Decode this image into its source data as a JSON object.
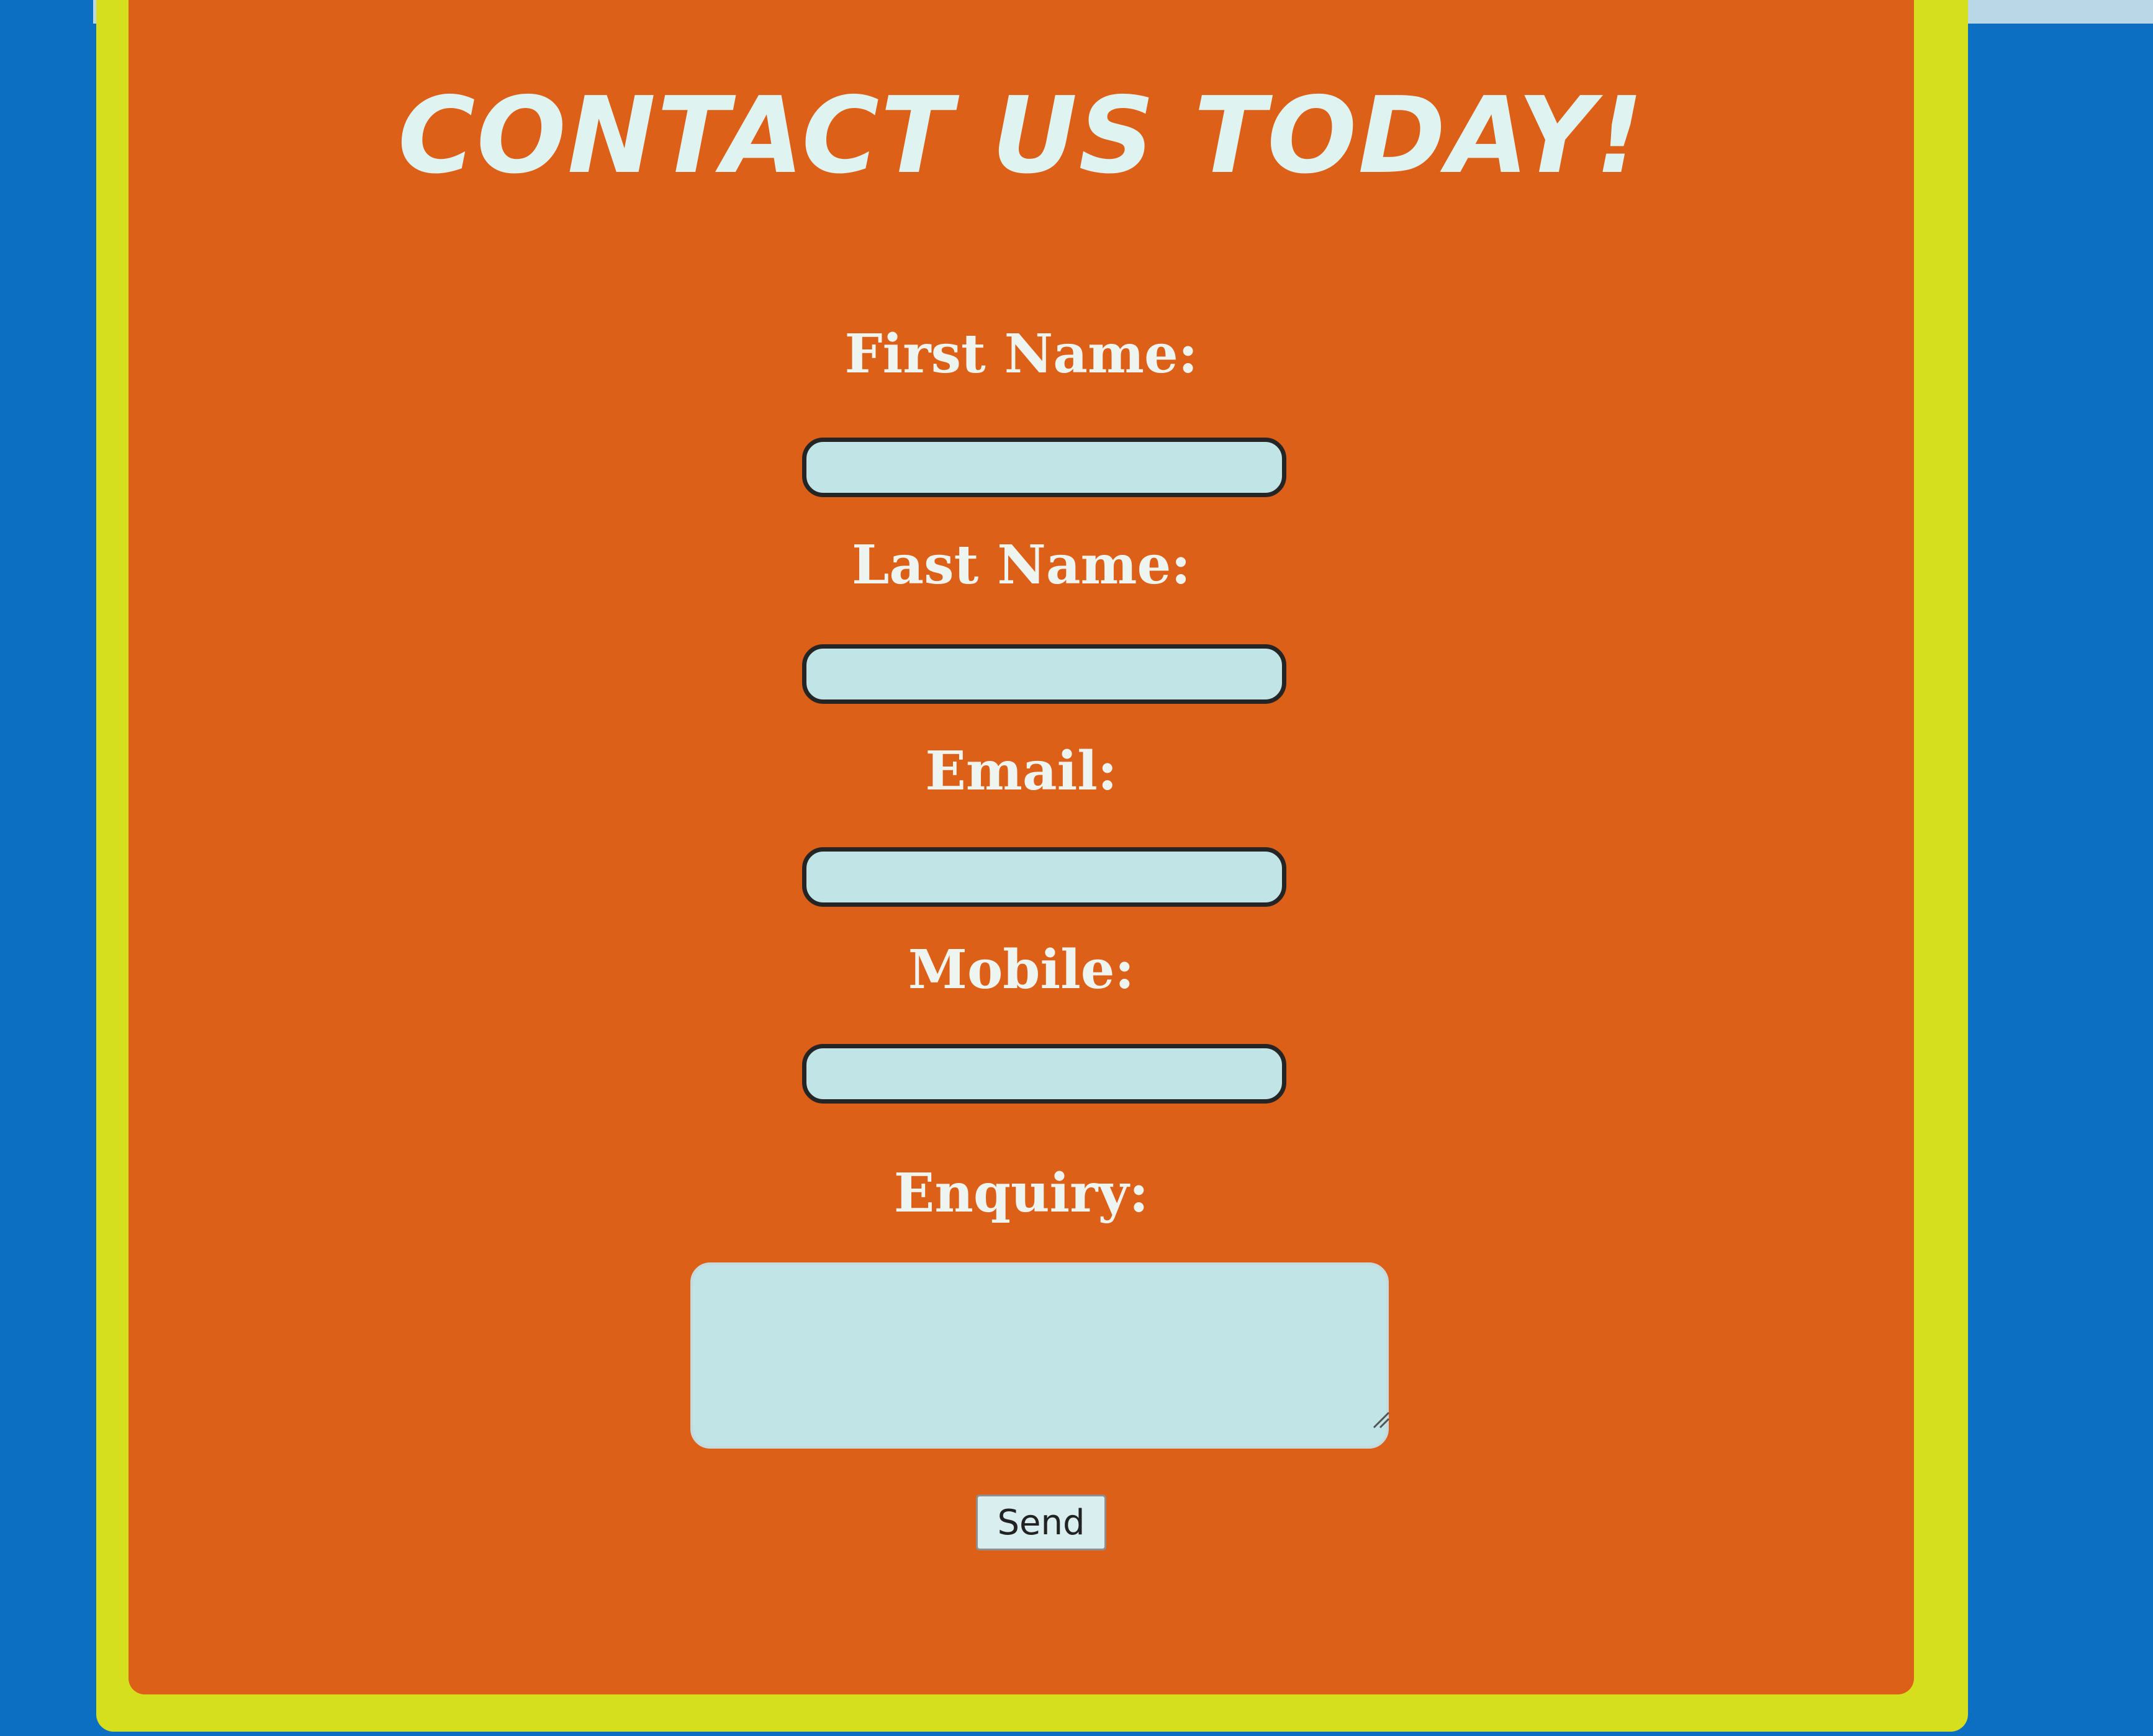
{
  "page": {
    "title": "CONTACT US TODAY!"
  },
  "form": {
    "first_name_label": "First Name:",
    "first_name_value": "",
    "last_name_label": "Last Name:",
    "last_name_value": "",
    "email_label": "Email:",
    "email_value": "",
    "mobile_label": "Mobile:",
    "mobile_value": "",
    "enquiry_label": "Enquiry:",
    "enquiry_value": "",
    "send_label": "Send"
  },
  "colors": {
    "background": "#0d6fc1",
    "frame": "#d6df1e",
    "panel": "#dd6018",
    "title_text": "#dff3f1",
    "field_fill": "#c1e4e7",
    "field_border": "#252525"
  }
}
